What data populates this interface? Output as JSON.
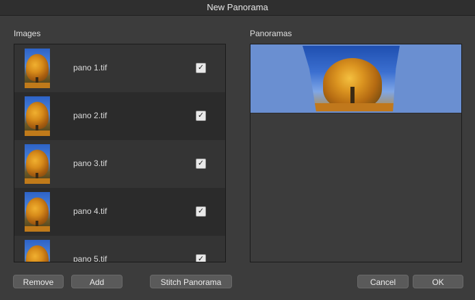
{
  "window": {
    "title": "New Panorama"
  },
  "images": {
    "label": "Images",
    "items": [
      {
        "name": "pano 1.tif",
        "checked": "✓"
      },
      {
        "name": "pano 2.tif",
        "checked": "✓"
      },
      {
        "name": "pano 3.tif",
        "checked": "✓"
      },
      {
        "name": "pano 4.tif",
        "checked": "✓"
      },
      {
        "name": "pano 5.tif",
        "checked": "✓"
      }
    ]
  },
  "panoramas": {
    "label": "Panoramas"
  },
  "buttons": {
    "remove": "Remove",
    "add": "Add",
    "stitch": "Stitch Panorama",
    "cancel": "Cancel",
    "ok": "OK"
  },
  "colors": {
    "panorama_background": "#6a8fd1",
    "window_background": "#3c3c3c"
  }
}
